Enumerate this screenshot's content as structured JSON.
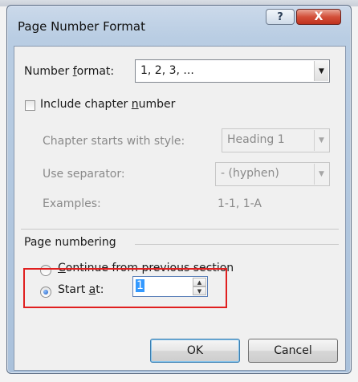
{
  "dialog": {
    "title": "Page Number Format",
    "help_glyph": "?",
    "close_glyph": "X"
  },
  "number_format": {
    "label_pre": "Number ",
    "label_accel": "f",
    "label_post": "ormat:",
    "value": "1, 2, 3, ..."
  },
  "include_chapter": {
    "label_pre": "Include chapter ",
    "label_accel": "n",
    "label_post": "umber",
    "checked": false
  },
  "chapter_style": {
    "label": "Chapter starts with style:",
    "value": "Heading 1"
  },
  "separator": {
    "label": "Use separator:",
    "value": "-  (hyphen)"
  },
  "examples": {
    "label": "Examples:",
    "value": "1-1, 1-A"
  },
  "page_numbering": {
    "heading": "Page numbering",
    "continue_pre": "",
    "continue_accel": "C",
    "continue_post": "ontinue from previous section",
    "continue_selected": false,
    "start_pre": "Start ",
    "start_accel": "a",
    "start_post": "t:",
    "start_selected": true,
    "start_value": "1"
  },
  "buttons": {
    "ok": "OK",
    "cancel": "Cancel"
  },
  "colors": {
    "highlight": "#e01f1f",
    "selection": "#3399ff",
    "close": "#c0321e"
  }
}
